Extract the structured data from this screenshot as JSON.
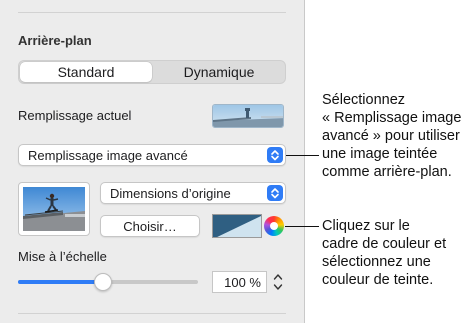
{
  "panel": {
    "section_title": "Arrière-plan",
    "tabs": [
      {
        "label": "Standard",
        "selected": true
      },
      {
        "label": "Dynamique",
        "selected": false
      }
    ],
    "current_fill_label": "Remplissage actuel",
    "fill_type_select": "Remplissage image avancé",
    "image_scale_select": "Dimensions d’origine",
    "choose_button": "Choisir…",
    "tint_color": "#2f5f82",
    "scale_label": "Mise à l’échelle",
    "scale_value": "100 %",
    "scale_slider_fraction": 0.47
  },
  "callouts": {
    "fill_callout": [
      "Sélectionnez",
      "« Remplissage image",
      "avancé » pour utiliser",
      "une image teintée",
      "comme arrière-plan."
    ],
    "tint_callout": [
      "Cliquez sur le",
      "cadre de couleur et",
      "sélectionnez une",
      "couleur de teinte."
    ]
  },
  "colors": {
    "accent": "#2f7cf6",
    "panel_bg": "#ececec"
  },
  "icons": {
    "popup_arrows": "chevron-up-down-icon",
    "color_wheel": "color-wheel-icon",
    "stepper": "stepper-icon"
  }
}
